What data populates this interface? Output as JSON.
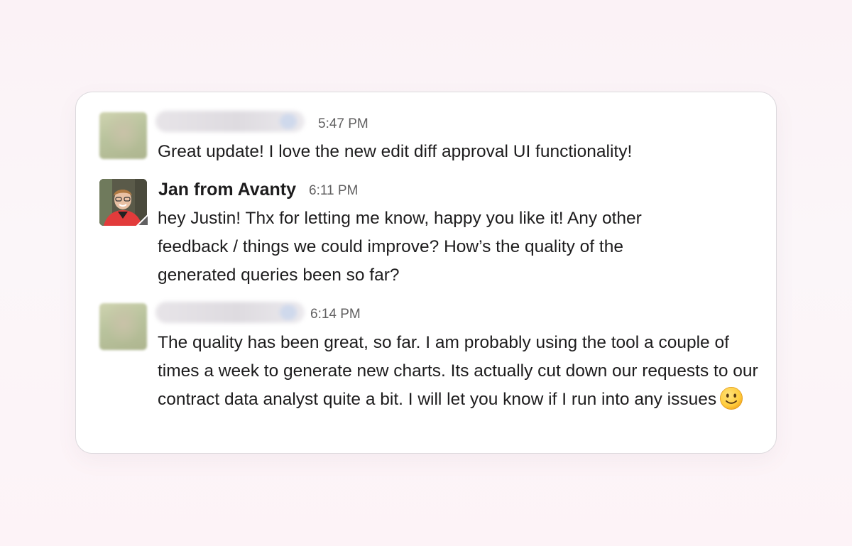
{
  "messages": [
    {
      "sender": "",
      "time": "5:47 PM",
      "text": "Great update! I love the new edit diff approval UI functionality!"
    },
    {
      "sender": "Jan from Avanty",
      "time": "6:11 PM",
      "text": "hey Justin! Thx for letting me know, happy you like it! Any other feedback / things we could improve? How’s the quality of the generated queries been so far?"
    },
    {
      "sender": "",
      "time": "6:14 PM",
      "text": "The quality has been great, so far. I am probably using the tool a couple of times a week to generate new charts. Its actually cut down our requests to our contract data analyst quite a bit. I will let you know if I run into any issues"
    }
  ],
  "icons": {
    "emoji": "slightly-smiling-face-icon",
    "status": "status-corner-icon"
  },
  "colors": {
    "text": "#1d1c1d",
    "timestamp": "#616061",
    "card_border": "#dcd9dd",
    "background": "#fbf4f8"
  }
}
